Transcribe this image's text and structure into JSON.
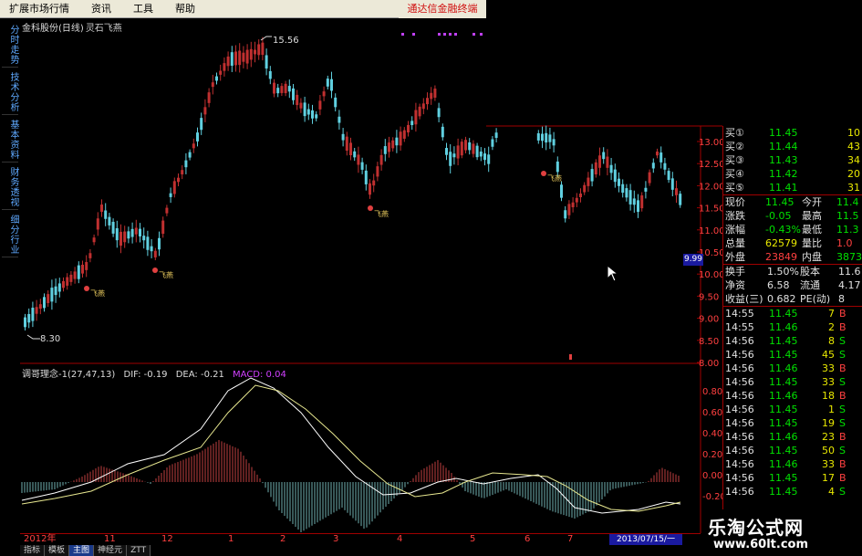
{
  "menu": {
    "items": [
      "扩展市场行情",
      "资讯",
      "工具",
      "帮助"
    ],
    "brand": "通达信金融终端"
  },
  "left_tabs": [
    "分时走势",
    "技术分析",
    "基本资料",
    "财务透视",
    "细分行业"
  ],
  "chart": {
    "stock_name": "金科股份(日线)",
    "signal_name": "灵石飞燕",
    "high_label": "15.56",
    "low_label": "8.30",
    "signal_tag": "飞燕",
    "current_price": "9.99",
    "y_ticks": [
      "13.00",
      "12.50",
      "12.00",
      "11.50",
      "11.00",
      "10.50",
      "10.00",
      "9.50",
      "9.00",
      "8.50",
      "8.00"
    ],
    "macd_ticks": [
      "0.80",
      "0.60",
      "0.40",
      "0.20",
      "0.00",
      "-0.20"
    ],
    "indicator": {
      "name": "调哥理念-1(27,47,13)",
      "dif": "DIF: -0.19",
      "dea": "DEA: -0.21",
      "macd": "MACD: 0.04"
    },
    "x_ticks": [
      "2012年",
      "11",
      "12",
      "1",
      "2",
      "3",
      "4",
      "5",
      "6",
      "7"
    ],
    "date_box": "2013/07/15/一"
  },
  "quote": {
    "bids": [
      {
        "label": "买①",
        "price": "11.45",
        "vol": "10"
      },
      {
        "label": "买②",
        "price": "11.44",
        "vol": "43"
      },
      {
        "label": "买③",
        "price": "11.43",
        "vol": "34"
      },
      {
        "label": "买④",
        "price": "11.42",
        "vol": "20"
      },
      {
        "label": "买⑤",
        "price": "11.41",
        "vol": "31"
      }
    ],
    "stats": [
      {
        "l1": "现价",
        "v1": "11.45",
        "l2": "今开",
        "v2": "11.4"
      },
      {
        "l1": "涨跌",
        "v1": "-0.05",
        "l2": "最高",
        "v2": "11.5"
      },
      {
        "l1": "涨幅",
        "v1": "-0.43%",
        "l2": "最低",
        "v2": "11.3"
      },
      {
        "l1": "总量",
        "v1": "62579",
        "l2": "量比",
        "v2": "1.0"
      },
      {
        "l1": "外盘",
        "v1": "23849",
        "l2": "内盘",
        "v2": "3873"
      }
    ],
    "stats2": [
      {
        "l1": "换手",
        "v1": "1.50%",
        "l2": "股本",
        "v2": "11.6"
      },
      {
        "l1": "净资",
        "v1": "6.58",
        "l2": "流通",
        "v2": "4.17"
      },
      {
        "l1": "收益(三)",
        "v1": "0.682",
        "l2": "PE(动)",
        "v2": "8"
      }
    ],
    "ticks": [
      {
        "time": "14:55",
        "price": "11.45",
        "vol": "7",
        "side": "B"
      },
      {
        "time": "14:55",
        "price": "11.46",
        "vol": "2",
        "side": "B"
      },
      {
        "time": "14:56",
        "price": "11.45",
        "vol": "8",
        "side": "S"
      },
      {
        "time": "14:56",
        "price": "11.45",
        "vol": "45",
        "side": "S"
      },
      {
        "time": "14:56",
        "price": "11.46",
        "vol": "33",
        "side": "B"
      },
      {
        "time": "14:56",
        "price": "11.45",
        "vol": "33",
        "side": "S"
      },
      {
        "time": "14:56",
        "price": "11.46",
        "vol": "18",
        "side": "B"
      },
      {
        "time": "14:56",
        "price": "11.45",
        "vol": "1",
        "side": "S"
      },
      {
        "time": "14:56",
        "price": "11.45",
        "vol": "19",
        "side": "S"
      },
      {
        "time": "14:56",
        "price": "11.46",
        "vol": "23",
        "side": "B"
      },
      {
        "time": "14:56",
        "price": "11.45",
        "vol": "50",
        "side": "S"
      },
      {
        "time": "14:56",
        "price": "11.46",
        "vol": "33",
        "side": "B"
      },
      {
        "time": "14:56",
        "price": "11.45",
        "vol": "17",
        "side": "B"
      },
      {
        "time": "14:56",
        "price": "11.45",
        "vol": "4",
        "side": "S"
      }
    ]
  },
  "bottom_tabs": [
    "指标",
    "模板",
    "主图",
    "神经元",
    "ZTT"
  ],
  "watermark": {
    "line1": "乐淘公式网",
    "line2": "www.60lt.com"
  },
  "colors": {
    "up": "#c03030",
    "down": "#60d0e0",
    "axis": "#a00000",
    "menu_bg": "#ece9d8"
  }
}
